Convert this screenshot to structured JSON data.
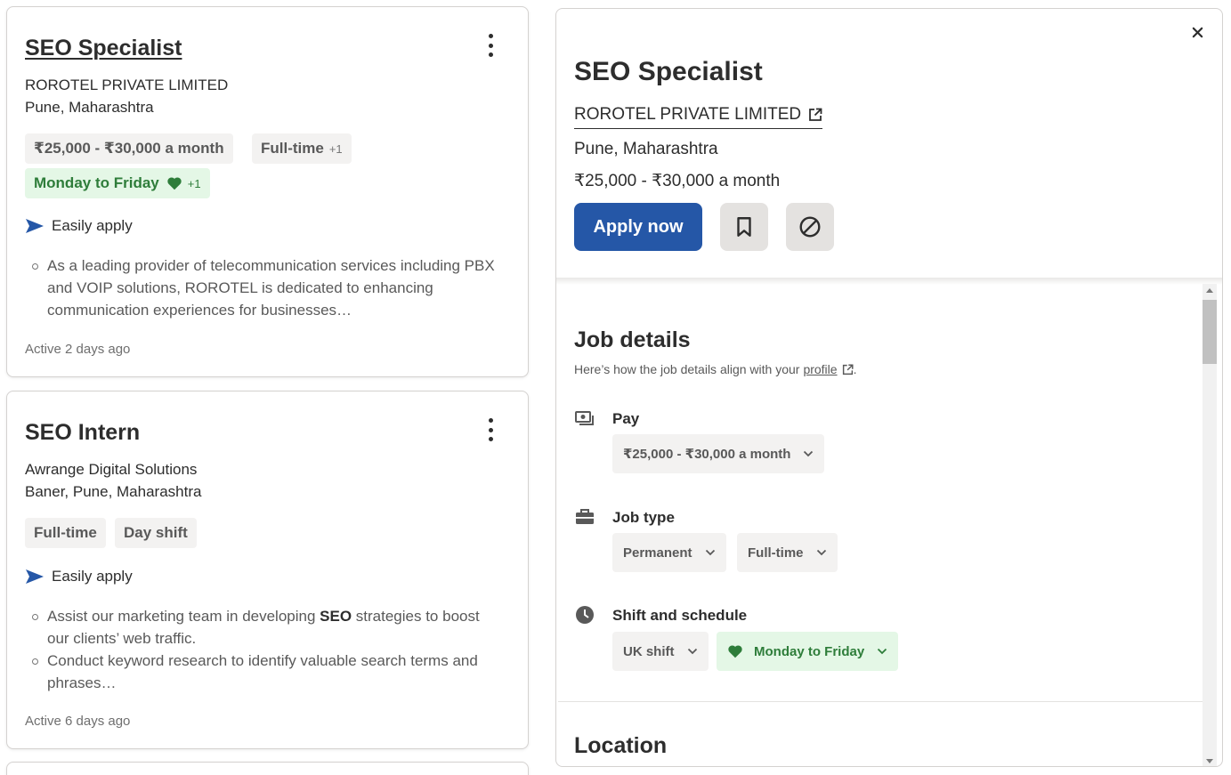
{
  "job_cards": [
    {
      "title": "SEO Specialist",
      "company": "ROROTEL PRIVATE LIMITED",
      "location": "Pune, Maharashtra",
      "salary_chip": "₹25,000 - ₹30,000 a month",
      "type_chip": "Full-time",
      "type_chip_extra": "+1",
      "schedule_chip": "Monday to Friday",
      "schedule_chip_extra": "+1",
      "easy_apply": "Easily apply",
      "snippet": [
        "As a leading provider of telecommunication services including PBX and VOIP solutions, ROROTEL is dedicated to enhancing communication experiences for businesses…"
      ],
      "active": "Active 2 days ago"
    },
    {
      "title": "SEO Intern",
      "company": "Awrange Digital Solutions",
      "location": "Baner, Pune, Maharashtra",
      "chips": [
        "Full-time",
        "Day shift"
      ],
      "easy_apply": "Easily apply",
      "snippet": [
        {
          "before": "Assist our marketing team in developing ",
          "bold": "SEO",
          "after": " strategies to boost our clients’ web traffic."
        },
        "Conduct keyword research to identify valuable search terms and phrases…"
      ],
      "active": "Active 6 days ago"
    }
  ],
  "detail": {
    "title": "SEO Specialist",
    "company": "ROROTEL PRIVATE LIMITED",
    "location": "Pune, Maharashtra",
    "salary": "₹25,000 - ₹30,000 a month",
    "apply_label": "Apply now",
    "job_details": {
      "title": "Job details",
      "subtitle_prefix": "Here’s how the job details align with your",
      "subtitle_link": "profile",
      "subtitle_suffix": ".",
      "pay": {
        "label": "Pay",
        "values": [
          "₹25,000 - ₹30,000 a month"
        ]
      },
      "job_type": {
        "label": "Job type",
        "values": [
          "Permanent",
          "Full-time"
        ]
      },
      "shift": {
        "label": "Shift and schedule",
        "values": [
          "UK shift",
          "Monday to Friday"
        ]
      }
    },
    "location_section_title": "Location"
  },
  "colors": {
    "accent": "#2557a7",
    "green_bg": "#e4f7e6",
    "green_text": "#2e7d3a",
    "chip_bg": "#f3f2f1"
  },
  "icons": [
    "kebab-menu-icon",
    "send-arrow-icon",
    "heart-icon",
    "external-link-icon",
    "bookmark-icon",
    "block-icon",
    "close-icon",
    "money-icon",
    "briefcase-icon",
    "clock-icon",
    "chevron-down-icon"
  ]
}
